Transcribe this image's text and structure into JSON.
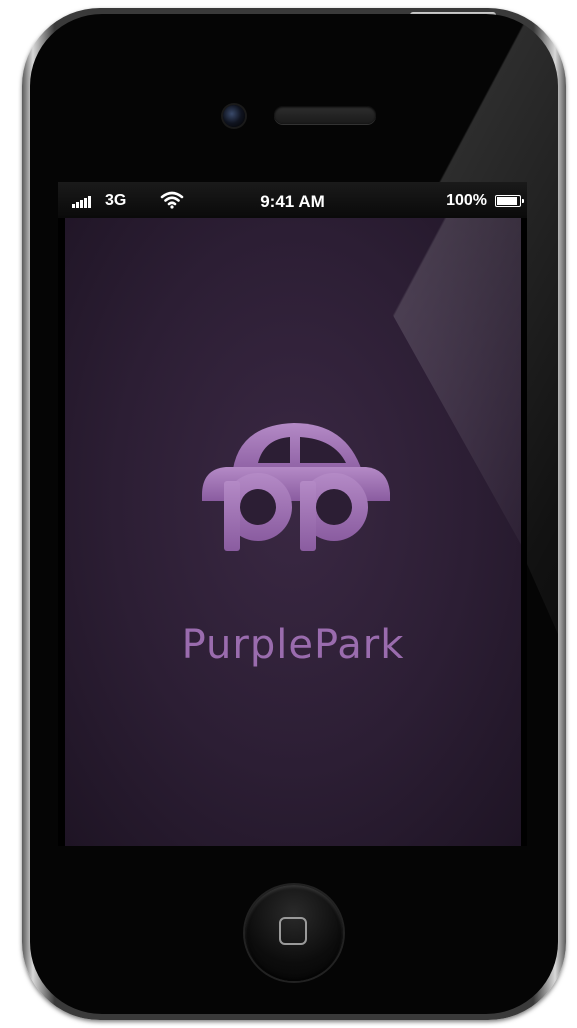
{
  "status_bar": {
    "network": "3G",
    "time": "9:41 AM",
    "battery_percent": "100%",
    "battery_level": 1.0,
    "signal_bars": 5
  },
  "app": {
    "name": "PurplePark",
    "logo_letters": "pp",
    "logo_icon": "car-icon",
    "brand_color": "#9a6cae",
    "background_color": "#2c1e34"
  },
  "device": {
    "home_icon": "home-button-square-icon"
  }
}
